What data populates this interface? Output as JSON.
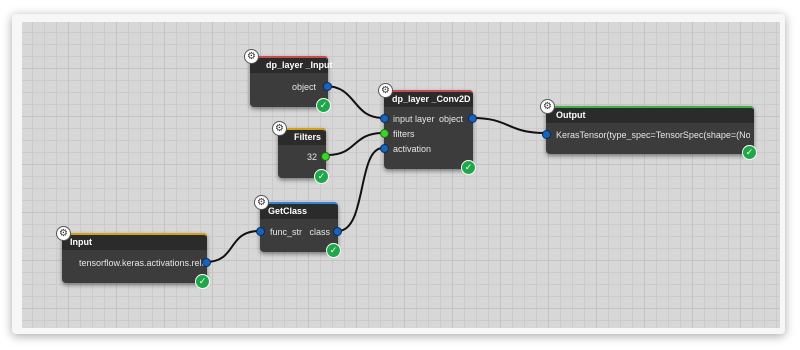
{
  "nodes": {
    "dp_layer_input": {
      "title": "dp_layer _Input",
      "outputs": [
        "object"
      ],
      "accent": "#c94b4b"
    },
    "filters": {
      "title": "Filters",
      "value": "32",
      "accent": "#d4a017"
    },
    "conv2d": {
      "title": "dp_layer _Conv2D",
      "inputs": [
        "input layer",
        "filters",
        "activation"
      ],
      "outputs": [
        "object"
      ],
      "accent": "#c94b4b"
    },
    "output": {
      "title": "Output",
      "value": "KerasTensor(type_spec=TensorSpec(shape=(Nor",
      "accent": "#3fae49"
    },
    "getclass": {
      "title": "GetClass",
      "inputs": [
        "func_str"
      ],
      "outputs": [
        "class"
      ],
      "accent": "#2f86d6"
    },
    "input": {
      "title": "Input",
      "value": "tensorflow.keras.activations.relu",
      "accent": "#d4a017"
    }
  },
  "icons": {
    "settings": "gear-icon",
    "status": "check-circle-icon"
  },
  "colors": {
    "canvas": "#d7d7d7",
    "node_body": "#3c3c3c",
    "port_default": "#1565c0",
    "port_active": "#39d627",
    "status_ok": "#1fa84a"
  }
}
